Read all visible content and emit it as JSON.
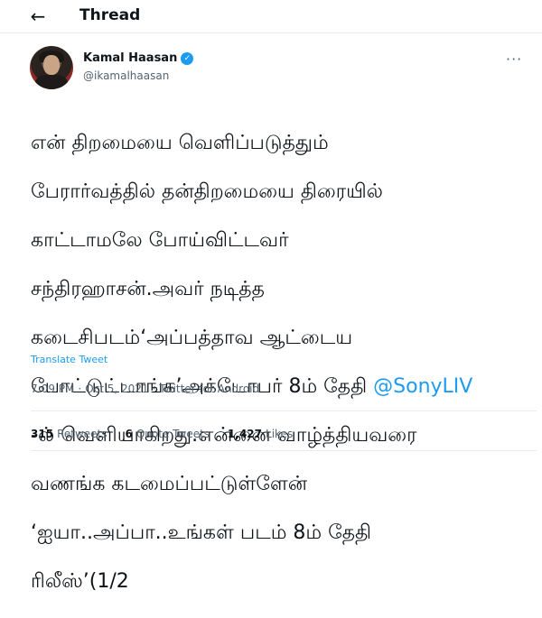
{
  "header": {
    "back_icon": "arrow-left-icon",
    "back_glyph": "←",
    "title": "Thread"
  },
  "tweet": {
    "author": {
      "display_name": "Kamal Haasan",
      "handle": "@ikamalhaasan",
      "verified_glyph": "✓",
      "avatar": "profile-photo"
    },
    "more_glyph": "···",
    "lines": [
      "என் திறமையை வெளிப்படுத்தும்",
      "பேரார்வத்தில் தன்திறமையை திரையில்",
      "காட்டாமலே போய்விட்டவர்",
      "சந்திரஹாசன்.அவர் நடித்த",
      "கடைசிபடம்‘அப்பத்தாவ ஆட்டைய",
      "போட்டுட்டாங்க’அக்டோபர் 8ம் தேதி ",
      "-ல் வெளியாகிறது.என்னை வாழ்த்தியவரை",
      "வணங்க கடமைப்பட்டுள்ளேன்",
      "‘ஐயா..அப்பா..உங்கள் படம் 8ம் தேதி",
      "ரிலீஸ்’(1/2"
    ],
    "mention": "@SonyLIV",
    "translate_label": "Translate Tweet",
    "time": "7:09 PM",
    "date": "Oct 5, 2021",
    "source": "Twitter for Android",
    "sep": "·"
  },
  "stats": {
    "retweets_count": "315",
    "retweets_label": "Retweets",
    "quotes_count": "6",
    "quotes_label": "Quote Tweets",
    "likes_count": "1,427",
    "likes_label": "Likes"
  },
  "colors": {
    "accent": "#1d9bf0",
    "text": "#0f1419",
    "muted": "#536471"
  }
}
